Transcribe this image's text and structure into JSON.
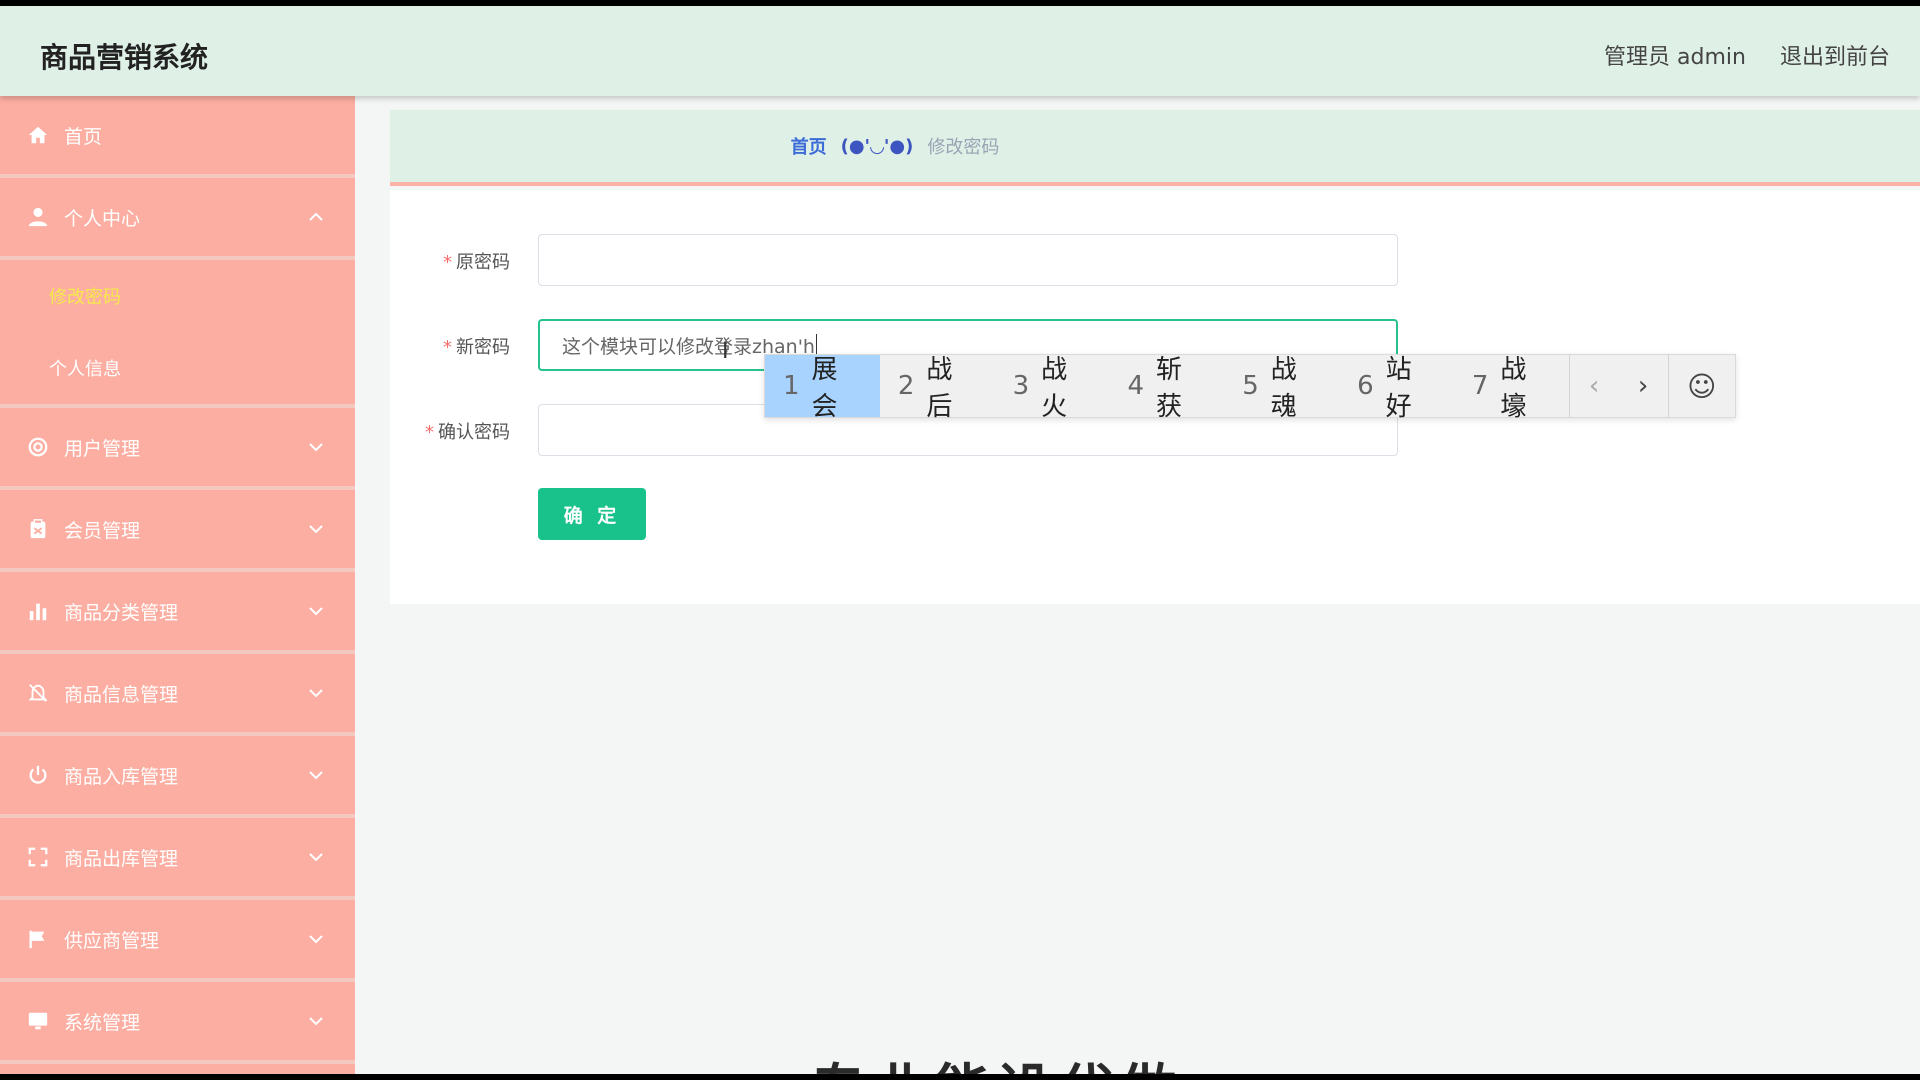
{
  "header": {
    "title": "商品营销系统",
    "admin_label": "管理员 admin",
    "exit_label": "退出到前台"
  },
  "sidebar": {
    "items": [
      {
        "label": "首页",
        "icon": "home-icon"
      },
      {
        "label": "个人中心",
        "icon": "user-icon",
        "expanded": true,
        "children": [
          {
            "label": "修改密码",
            "active": true
          },
          {
            "label": "个人信息",
            "active": false
          }
        ]
      },
      {
        "label": "用户管理",
        "icon": "lifebuoy-icon"
      },
      {
        "label": "会员管理",
        "icon": "clipboard-icon"
      },
      {
        "label": "商品分类管理",
        "icon": "bar-chart-icon"
      },
      {
        "label": "商品信息管理",
        "icon": "bell-off-icon"
      },
      {
        "label": "商品入库管理",
        "icon": "power-icon"
      },
      {
        "label": "商品出库管理",
        "icon": "fullscreen-icon"
      },
      {
        "label": "供应商管理",
        "icon": "flag-icon"
      },
      {
        "label": "系统管理",
        "icon": "monitor-icon"
      }
    ],
    "colors": {
      "bg": "#fcaea2",
      "active_text": "#f5e94b"
    }
  },
  "breadcrumb": {
    "home": "首页",
    "separator": "(●'◡'●)",
    "current": "修改密码"
  },
  "form": {
    "old_password": {
      "label": "原密码",
      "value": ""
    },
    "new_password": {
      "label": "新密码",
      "value": "这个模块可以修改登录zhan'h"
    },
    "confirm_password": {
      "label": "确认密码",
      "value": ""
    },
    "submit_label": "确 定",
    "accent": "#19c28a"
  },
  "ime": {
    "candidates": [
      {
        "num": "1",
        "text": "展会",
        "selected": true
      },
      {
        "num": "2",
        "text": "战后",
        "selected": false
      },
      {
        "num": "3",
        "text": "战火",
        "selected": false
      },
      {
        "num": "4",
        "text": "斩获",
        "selected": false
      },
      {
        "num": "5",
        "text": "战魂",
        "selected": false
      },
      {
        "num": "6",
        "text": "站好",
        "selected": false
      },
      {
        "num": "7",
        "text": "战壕",
        "selected": false
      }
    ],
    "prev": "‹",
    "next": "›",
    "emoji": "☺"
  },
  "caption": "专业能设代做"
}
